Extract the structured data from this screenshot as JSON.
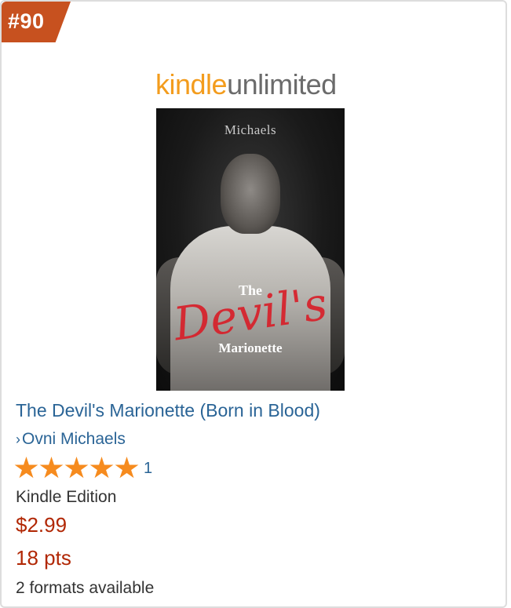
{
  "rank": "#90",
  "badges": {
    "ku_kindle": "kindle",
    "ku_unlimited": "unlimited"
  },
  "cover": {
    "author": "Michaels",
    "the": "The",
    "devil": "Devil's",
    "marionette": "Marionette"
  },
  "product": {
    "title": "The Devil's Marionette (Born in Blood)",
    "author": "Ovni Michaels",
    "rating_stars": 5,
    "rating_count": "1",
    "format": "Kindle Edition",
    "price": "$2.99",
    "points": "18 pts",
    "formats_available": "2 formats available"
  },
  "colors": {
    "rank_badge": "#c7511f",
    "link": "#2a6496",
    "price": "#b12704",
    "star": "#f68b1e",
    "ku_orange": "#f39c1d"
  }
}
